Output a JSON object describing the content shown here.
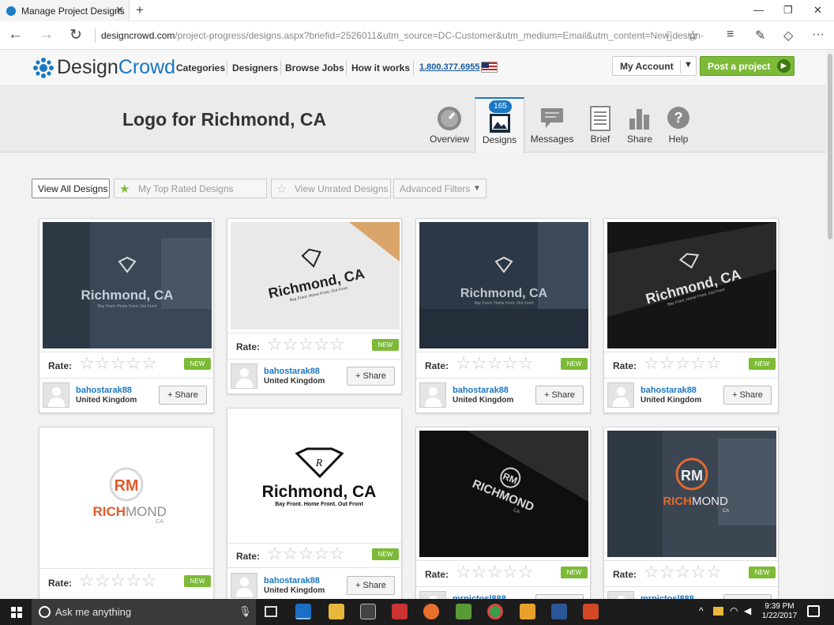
{
  "browser": {
    "tab_title": "Manage Project Designs",
    "tab_close": "✕",
    "new_tab": "+",
    "url_host": "designcrowd.com",
    "url_path": "/project-progress/designs.aspx?briefid=2526011&utm_source=DC-Customer&utm_medium=Email&utm_content=New-design-",
    "win_min": "—",
    "win_max": "❐",
    "win_close": "✕"
  },
  "site": {
    "logo_design": "Design",
    "logo_crowd": "Crowd",
    "nav": [
      "Categories",
      "Designers",
      "Browse Jobs",
      "How it works"
    ],
    "phone": "1.800.377.6955",
    "account_label": "My Account",
    "post_label": "Post a project",
    "brand_color": "#1a77c4",
    "accent_color": "#7cba38"
  },
  "project": {
    "title": "Logo for Richmond, CA",
    "tabs": [
      {
        "label": "Overview",
        "icon": "gauge-icon"
      },
      {
        "label": "Designs",
        "icon": "image-icon",
        "badge": "165"
      },
      {
        "label": "Messages",
        "icon": "chat-icon"
      },
      {
        "label": "Brief",
        "icon": "document-icon"
      },
      {
        "label": "Share",
        "icon": "bar-chart-icon"
      },
      {
        "label": "Help",
        "icon": "question-icon"
      }
    ]
  },
  "filters": {
    "all": "View All Designs",
    "top": "My Top Rated Designs",
    "unrated": "View Unrated Designs",
    "advanced": "Advanced Filters"
  },
  "card_labels": {
    "rate": "Rate:",
    "new": "NEW",
    "share": "+ Share",
    "stars": "☆☆☆☆☆"
  },
  "designs": [
    {
      "designer": "bahostarak88",
      "country": "United Kingdom",
      "logo": "Richmond, CA",
      "tagline": "Bay Front. Home Front. Out Front"
    },
    {
      "designer": "bahostarak88",
      "country": "United Kingdom",
      "logo": "Richmond, CA",
      "tagline": "Bay Front. Home Front. Out Front"
    },
    {
      "designer": "bahostarak88",
      "country": "United Kingdom",
      "logo": "Richmond, CA",
      "tagline": "Bay Front. Home Front. Out Front"
    },
    {
      "designer": "bahostarak88",
      "country": "United Kingdom",
      "logo": "Richmond, CA",
      "tagline": "Bay Front. Home Front. Out Front"
    },
    {
      "designer": "",
      "country": "",
      "logo_a": "RICH",
      "logo_b": "MOND",
      "logo_sub": "CA",
      "mono": "RM"
    },
    {
      "designer": "bahostarak88",
      "country": "United Kingdom",
      "logo": "Richmond, CA",
      "tagline": "Bay Front. Home Front. Out Front"
    },
    {
      "designer": "mrpictosl888",
      "country": "",
      "logo": "RICHMOND",
      "logo_sub": "CA",
      "mono": "RM"
    },
    {
      "designer": "mrpictosl888",
      "country": "",
      "logo_a": "RICH",
      "logo_b": "MOND",
      "logo_sub": "CA",
      "mono": "RM"
    }
  ],
  "taskbar": {
    "search_placeholder": "Ask me anything",
    "time": "9:39 PM",
    "date": "1/22/2017"
  }
}
